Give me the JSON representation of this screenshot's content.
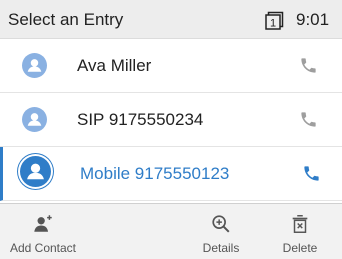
{
  "header": {
    "title": "Select an Entry",
    "line_icon": "line-1-icon",
    "line_number": "1",
    "time": "9:01"
  },
  "entries": [
    {
      "label": "Ava Miller",
      "avatar_icon": "contact-avatar-icon",
      "call_icon": "phone-icon",
      "selected": false
    },
    {
      "label": "SIP 9175550234",
      "avatar_icon": "contact-avatar-icon",
      "call_icon": "phone-icon",
      "selected": false
    },
    {
      "label": "Mobile 9175550123",
      "avatar_icon": "contact-avatar-icon",
      "call_icon": "phone-icon",
      "selected": true
    }
  ],
  "softkeys": [
    {
      "label": "Add Contact",
      "icon": "add-contact-icon"
    },
    {
      "label": "Details",
      "icon": "zoom-in-icon"
    },
    {
      "label": "Delete",
      "icon": "delete-icon"
    }
  ],
  "colors": {
    "accent": "#2f7dc8",
    "avatar": "#8ab1e2",
    "header_bg": "#ededed",
    "softkey_bg": "#f2f2f2",
    "phone_icon": "#9e9e9e"
  }
}
